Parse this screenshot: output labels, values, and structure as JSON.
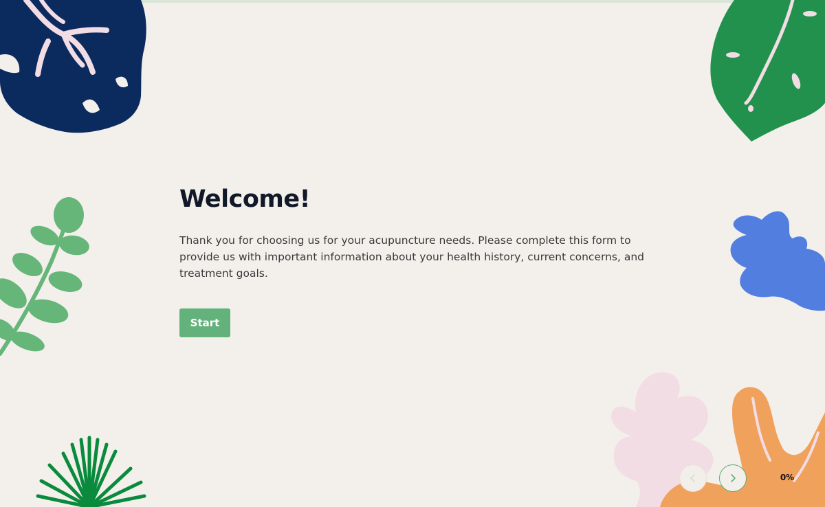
{
  "welcome": {
    "title": "Welcome!",
    "description": "Thank you for choosing us for your acupuncture needs. Please complete this form to provide us with important information about your health history, current concerns, and treatment goals.",
    "start_label": "Start"
  },
  "progress": {
    "percent_label": "0%",
    "value": 0
  },
  "navigation": {
    "prev_icon": "chevron-left-icon",
    "next_icon": "chevron-right-icon"
  },
  "colors": {
    "background": "#f3f0ec",
    "accent_green": "#63b17b",
    "leaf_navy": "#0b2a5e",
    "leaf_green": "#21914d",
    "leaf_light_green": "#66b579",
    "leaf_blue": "#527ee0",
    "leaf_pink": "#f3dde4",
    "leaf_orange": "#f0a15c"
  }
}
